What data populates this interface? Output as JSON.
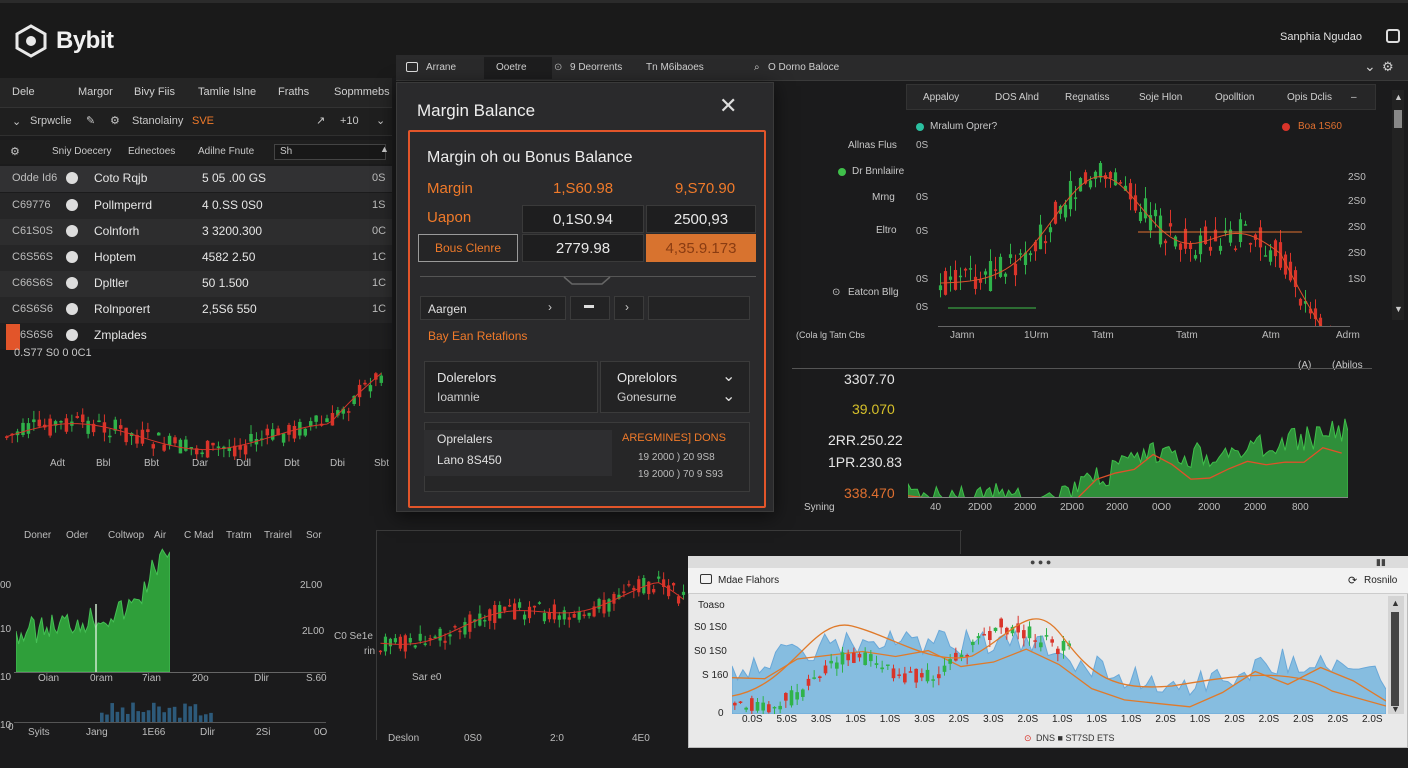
{
  "app": {
    "logo_text": "Bybit",
    "user_label": "Sanphia Ngudao"
  },
  "left_panel": {
    "tabs": [
      "Dele",
      "Margor",
      "Bivy Fiis",
      "Tamlie Islne",
      "Fraths",
      "Sopmmebs"
    ],
    "sub": {
      "left": "Srpwclie",
      "mid": "Stanolainy",
      "accent": "SVE",
      "right": "+10"
    },
    "cols": [
      "Sniy Doecery",
      "Ednectoes",
      "Adilne Fnute",
      "Sh"
    ],
    "rows": [
      {
        "c1": "Odde Id6",
        "name": "Coto Rqjb",
        "value": "5 05 .00 GS",
        "c4": "0S"
      },
      {
        "c1": "C69776",
        "name": "Pollmperrd",
        "value": "4 0.SS  0S0",
        "c4": "1S"
      },
      {
        "c1": "C61S0S",
        "name": "Colnforh",
        "value": "3 3200.300",
        "c4": "0C"
      },
      {
        "c1": "C6S56S",
        "name": "Hoptem",
        "value": "4582 2.50",
        "c4": "1C"
      },
      {
        "c1": "C66S6S",
        "name": "Dpltler",
        "value": "50  1.500",
        "c4": "1C"
      },
      {
        "c1": "C6S6S6",
        "name": "Rolnporert",
        "value": "2,5S6 550",
        "c4": "1C"
      },
      {
        "c1": "C6S6S6",
        "name": "Zmplades",
        "value": "",
        "c4": ""
      }
    ],
    "chart_caption": "0.S77 S0 0 0C1",
    "x_ticks": [
      "Adt",
      "Bbl",
      "Bbt",
      "Dar",
      "Ddl",
      "Dbt",
      "Dbi",
      "Sbt"
    ]
  },
  "window_bar": {
    "tab1": "Arrane",
    "tab2": "Ooetre",
    "tab3": "9 Deorrents",
    "tab4": "Tn M6ibaoes",
    "search": "O Dorno Baloce"
  },
  "modal": {
    "title": "Margin Balance",
    "heading": "Margin oh ou Bonus Balance",
    "rows": [
      {
        "label": "Margin",
        "v1": "1,S60.98",
        "v2": "9,S70.90"
      },
      {
        "label": "Uapon",
        "v1": "0,1S0.94",
        "v2": "2500,93"
      },
      {
        "label": "Bous Clenre",
        "v1": "2779.98",
        "v2": "4,35.9.173"
      }
    ],
    "field_label": "Aargen",
    "link_text": "Bay Ean Retafions",
    "dropdown1": {
      "title": "Dolerelors",
      "sub": "Ioamnie"
    },
    "dropdown2": {
      "title": "Oprelolors",
      "sub": "Gonesurne"
    },
    "info": {
      "title": "Oprelalers",
      "sub": "Lano  8S450",
      "accent": "AREGMINES] DONS",
      "l1": "19 2000 ) 20 9S8",
      "l2": "19 2000 ) 70 9 S93"
    }
  },
  "right_top": {
    "tabs": [
      "Appaloy",
      "DOS Alnd",
      "Regnatiss",
      "Soje Hlon",
      "Opolltion",
      "Opis Dclis"
    ],
    "legend1": "Mralum Oprer?",
    "legend2": "Boa 1S60",
    "side_labels": [
      "Allnas Flus",
      "Dr Bnnlaiire",
      "Mrng",
      "Eltro",
      "Eatcon Bllg"
    ],
    "dot_label": "Dr Bnnlaiire",
    "y_ticks": [
      "0S",
      "0S",
      "0S",
      "0S",
      "0S"
    ],
    "y_ticks_right": [
      "2S0",
      "2S0",
      "2S0",
      "2S0",
      "1S0"
    ],
    "x_ticks": [
      "Jamn",
      "1Urm",
      "Tatm",
      "Tatm",
      "Atm",
      "Adrm"
    ],
    "x_caption": "(Cola lg Tatn   Cbs"
  },
  "right_mid": {
    "values": [
      "3307.70",
      "39.070",
      "2RR.250.22",
      "1PR.230.83",
      "338.470"
    ],
    "x_ticks": [
      "40",
      "2D00",
      "2000",
      "2D00",
      "2000",
      "0O0",
      "2000",
      "2000",
      "800"
    ],
    "caption_left": "Syning",
    "caption_right1": "(A)",
    "caption_right2": "(Abilos"
  },
  "bottom_left": {
    "tabs": [
      "Doner",
      "Oder",
      "Coltwop",
      "Air",
      "C Mad",
      "Tratm",
      "Trairel",
      "Sor"
    ],
    "y_ticks": [
      "00",
      "10",
      "10",
      "10",
      "0"
    ],
    "y_ticks_right": [
      "2L00",
      "2L00"
    ],
    "x_ticks": [
      "Oian",
      "0ram",
      "7ian",
      "20o",
      "Dlir",
      "S.60"
    ],
    "x_ticks2": [
      "Syits",
      "Jang",
      "1E66",
      "Dlir",
      "2Si",
      "0O"
    ]
  },
  "bottom_mid": {
    "left_label": "C0 Se1e",
    "sub_label": "rin",
    "caption": "Sar e0",
    "x_ticks": [
      "Deslon",
      "0S0",
      "2:0",
      "4E0"
    ]
  },
  "bottom_right": {
    "title": "Mdae Flahors",
    "button": "Rosnilo",
    "y_labels": [
      "Toaso",
      "S0 1S0",
      "S0 1S0",
      "S 160",
      "0"
    ],
    "x_ticks": [
      "0.0S",
      "5.0S",
      "3.0S",
      "1.0S",
      "1.0S",
      "3.0S",
      "2.0S",
      "3.0S",
      "2.0S",
      "1.0S",
      "1.0S",
      "1.0S",
      "2.0S",
      "1.0S",
      "2.0S",
      "2.0S",
      "2.0S",
      "2.0S",
      "2.0S"
    ],
    "footer": "DNS  ■ ST7SD ETS"
  }
}
